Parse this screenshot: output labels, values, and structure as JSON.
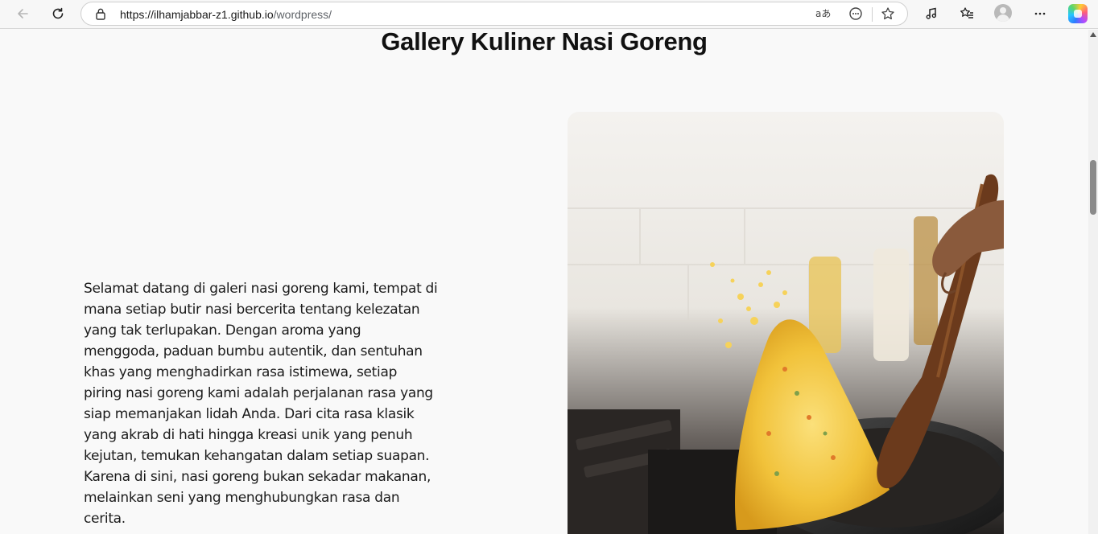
{
  "browser": {
    "url_host": "https://ilhamjabbar-z1.github.io",
    "url_path": "/wordpress/",
    "icons": [
      "back-arrow-icon",
      "reload-icon",
      "lock-icon",
      "read-aloud-icon",
      "extensions-icon",
      "favorite-star-icon",
      "media-control-icon",
      "favorites-list-icon",
      "profile-avatar",
      "more-menu-icon",
      "copilot-icon"
    ]
  },
  "page": {
    "title": "Gallery Kuliner Nasi Goreng",
    "intro": "Selamat datang di galeri nasi goreng kami, tempat di mana setiap butir nasi bercerita tentang kelezatan yang tak terlupakan. Dengan aroma yang menggoda, paduan bumbu autentik, dan sentuhan khas yang menghadirkan rasa istimewa, setiap piring nasi goreng kami adalah perjalanan rasa yang siap memanjakan lidah Anda. Dari cita rasa klasik yang akrab di hati hingga kreasi unik yang penuh kejutan, temukan kehangatan dalam setiap suapan. Karena di sini, nasi goreng bukan sekadar makanan, melainkan seni yang menghubungkan rasa dan cerita."
  },
  "colors": {
    "page_bg": "#f9f9f9",
    "text": "#1b1b1b",
    "rice": "#f2c542",
    "pan": "#2b2b2b",
    "spatula": "#6b3a1c"
  }
}
